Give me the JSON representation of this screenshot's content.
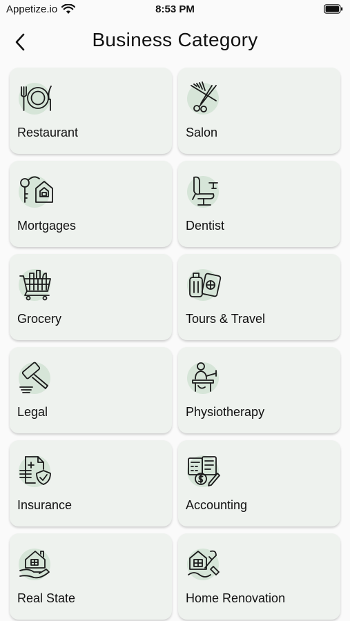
{
  "status_bar": {
    "carrier": "Appetize.io",
    "time": "8:53 PM"
  },
  "header": {
    "title": "Business Category"
  },
  "categories": [
    {
      "label": "Restaurant",
      "icon": "restaurant-icon"
    },
    {
      "label": "Salon",
      "icon": "salon-icon"
    },
    {
      "label": "Mortgages",
      "icon": "mortgages-icon"
    },
    {
      "label": "Dentist",
      "icon": "dentist-icon"
    },
    {
      "label": "Grocery",
      "icon": "grocery-icon"
    },
    {
      "label": "Tours & Travel",
      "icon": "tours-travel-icon"
    },
    {
      "label": "Legal",
      "icon": "legal-icon"
    },
    {
      "label": "Physiotherapy",
      "icon": "physiotherapy-icon"
    },
    {
      "label": "Insurance",
      "icon": "insurance-icon"
    },
    {
      "label": "Accounting",
      "icon": "accounting-icon"
    },
    {
      "label": "Real State",
      "icon": "real-state-icon"
    },
    {
      "label": "Home Renovation",
      "icon": "home-renovation-icon"
    }
  ],
  "colors": {
    "card_bg": "#eef2ee",
    "icon_blob": "#d6e5d8",
    "page_bg": "#fafafa"
  }
}
